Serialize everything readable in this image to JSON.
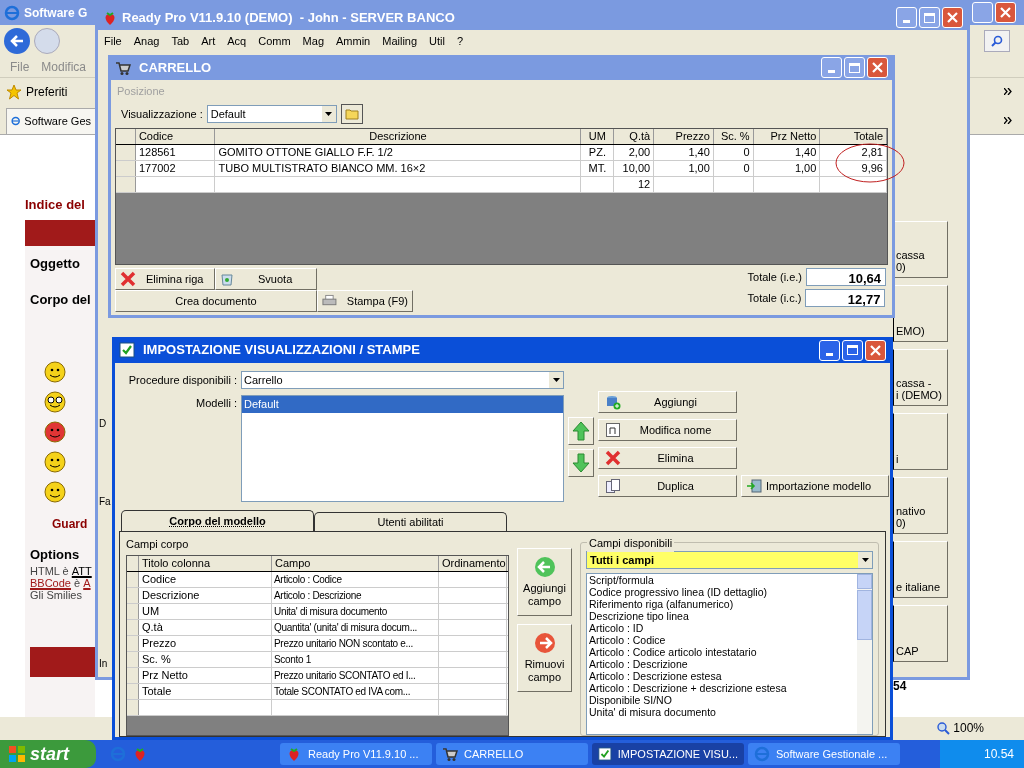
{
  "browser": {
    "title": "Software G",
    "active": false,
    "menu": [
      "File",
      "Modifica"
    ],
    "favorites": "Preferiti",
    "tab": "Software Ges",
    "page": {
      "heading": "Indice del",
      "labels": [
        "Oggetto",
        "Corpo del"
      ],
      "guard": "Guard",
      "options_title": "Options",
      "options": [
        [
          {
            "text": "HTML è ",
            "link": false
          },
          {
            "text": "ATT",
            "link": true
          }
        ],
        [
          {
            "text": "BBCode",
            "link": true
          },
          {
            "text": " è ",
            "link": false
          },
          {
            "text": "A",
            "link": true
          }
        ],
        [
          {
            "text": "Gli Smilies",
            "link": false
          }
        ]
      ]
    },
    "zoom": "100%"
  },
  "app": {
    "title": "Ready Pro V11.9.10 (DEMO)  - John - SERVER BANCO",
    "active": false,
    "menu": [
      "File",
      "Anag",
      "Tab",
      "Art",
      "Acq",
      "Comm",
      "Mag",
      "Ammin",
      "Mailing",
      "Util",
      "?"
    ],
    "right_tiles": [
      {
        "lines": [
          "cassa",
          "0)"
        ]
      },
      {
        "lines": [
          "EMO)"
        ]
      },
      {
        "lines": [
          "cassa -",
          "i (DEMO)"
        ]
      },
      {
        "lines": [
          "i"
        ]
      },
      {
        "lines": [
          "nativo",
          "0)"
        ]
      },
      {
        "lines": [
          "e italiane"
        ]
      },
      {
        "lines": [
          "CAP"
        ]
      }
    ],
    "status_value": "54",
    "left_tiles": [
      "D",
      "Fa",
      "In"
    ]
  },
  "carrello": {
    "title": "CARRELLO",
    "active": false,
    "position_label": "Posizione",
    "view_label": "Visualizzazione :",
    "view_value": "Default",
    "columns": [
      {
        "label": "Codice",
        "kind": "text"
      },
      {
        "label": "Descrizione",
        "kind": "text"
      },
      {
        "label": "UM",
        "kind": "center"
      },
      {
        "label": "Q.tà",
        "kind": "number"
      },
      {
        "label": "Prezzo",
        "kind": "number"
      },
      {
        "label": "Sc. %",
        "kind": "number"
      },
      {
        "label": "Prz Netto",
        "kind": "number"
      },
      {
        "label": "Totale",
        "kind": "number"
      }
    ],
    "rows": [
      [
        "128561",
        "GOMITO OTTONE GIALLO F.F. 1/2",
        "PZ.",
        "2,00",
        "1,40",
        "0",
        "1,40",
        "2,81"
      ],
      [
        "177002",
        "TUBO MULTISTRATO BIANCO MM. 16×2",
        "MT.",
        "10,00",
        "1,00",
        "0",
        "1,00",
        "9,96"
      ]
    ],
    "total_quantity": "12",
    "buttons": {
      "delete_row": "Elimina riga",
      "empty": "Svuota",
      "create": "Crea documento",
      "print": "Stampa (F9)"
    },
    "totals": [
      {
        "label": "Totale (i.e.)",
        "value": "10,64"
      },
      {
        "label": "Totale (i.c.)",
        "value": "12,77"
      }
    ]
  },
  "impostazione": {
    "title": "IMPOSTAZIONE VISUALIZZAZIONI / STAMPE",
    "active": true,
    "procedure_label": "Procedure disponibili :",
    "procedure_value": "Carrello",
    "models_label": "Modelli :",
    "models": [
      {
        "label": "Default",
        "selected": true
      }
    ],
    "buttons": [
      "Aggiungi",
      "Modifica nome",
      "Elimina",
      "Duplica"
    ],
    "import_button": "Importazione modello",
    "tabs": [
      {
        "label": "Corpo del modello",
        "selected": true
      },
      {
        "label": "Utenti abilitati",
        "selected": false
      }
    ],
    "fields_label": "Campi corpo",
    "field_columns": [
      "Titolo colonna",
      "Campo",
      "Ordinamento"
    ],
    "fields": [
      {
        "title": "Codice",
        "field": "Articolo : Codice"
      },
      {
        "title": "Descrizione",
        "field": "Articolo : Descrizione"
      },
      {
        "title": "UM",
        "field": "Unita' di misura documento"
      },
      {
        "title": "Q.tà",
        "field": "Quantita' (unita' di misura docum..."
      },
      {
        "title": "Prezzo",
        "field": "Prezzo unitario NON scontato e..."
      },
      {
        "title": "Sc. %",
        "field": "Sconto 1"
      },
      {
        "title": "Prz Netto",
        "field": "Prezzo unitario SCONTATO ed I..."
      },
      {
        "title": "Totale",
        "field": "Totale SCONTATO ed IVA com..."
      }
    ],
    "add_field": "Aggiungi campo",
    "remove_field": "Rimuovi campo",
    "available_label": "Campi disponibili",
    "available_filter": "Tutti i campi",
    "available": [
      "Script/formula",
      "Codice progressivo linea (ID dettaglio)",
      "Riferimento riga (alfanumerico)",
      "Descrizione tipo linea",
      "Articolo : ID",
      "Articolo : Codice",
      "Articolo : Codice articolo intestatario",
      "Articolo : Descrizione",
      "Articolo : Descrizione estesa",
      "Articolo : Descrizione + descrizione estesa",
      "Disponibile SI/NO",
      "Unita' di misura documento"
    ]
  },
  "taskbar": {
    "start": "start",
    "tasks": [
      {
        "label": "Ready Pro V11.9.10 ...",
        "selected": false
      },
      {
        "label": "CARRELLO",
        "selected": false
      },
      {
        "label": "IMPOSTAZIONE VISU...",
        "selected": true
      },
      {
        "label": "Software Gestionale ...",
        "selected": false
      }
    ],
    "clock": "10.54"
  }
}
